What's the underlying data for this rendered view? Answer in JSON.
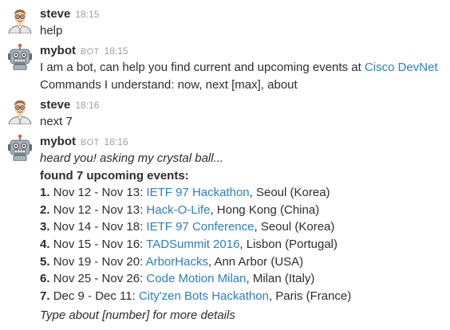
{
  "messages": [
    {
      "sender": "steve",
      "time": "18:15",
      "text": "help"
    },
    {
      "sender": "mybot",
      "badge": "BOT",
      "time": "18:15",
      "line1_prefix": "I am a bot, can help you find current and upcoming events at ",
      "line1_link": "Cisco DevNet",
      "line2": "Commands I understand: now, next [max], about"
    },
    {
      "sender": "steve",
      "time": "18:16",
      "text": "next 7"
    },
    {
      "sender": "mybot",
      "badge": "BOT",
      "time": "18:16",
      "intro": "heard you! asking my crystal ball...",
      "heading": "found 7 upcoming events:",
      "events": [
        {
          "num": "1.",
          "dates": "Nov 12 - Nov 13:",
          "name": "IETF 97 Hackathon",
          "location": ", Seoul (Korea)"
        },
        {
          "num": "2.",
          "dates": "Nov 12 - Nov 13:",
          "name": "Hack-O-Life",
          "location": ", Hong Kong (China)"
        },
        {
          "num": "3.",
          "dates": "Nov 14 - Nov 18:",
          "name": "IETF 97 Conference",
          "location": ", Seoul (Korea)"
        },
        {
          "num": "4.",
          "dates": "Nov 15 - Nov 16:",
          "name": "TADSummit 2016",
          "location": ", Lisbon (Portugal)"
        },
        {
          "num": "5.",
          "dates": "Nov 19 - Nov 20:",
          "name": "ArborHacks",
          "location": ", Ann Arbor (USA)"
        },
        {
          "num": "6.",
          "dates": "Nov 25 - Nov 26:",
          "name": "Code Motion Milan",
          "location": ", Milan (Italy)"
        },
        {
          "num": "7.",
          "dates": "Dec 9 - Dec 11:",
          "name": "City'zen Bots Hackathon",
          "location": ", Paris (France)"
        }
      ],
      "footer": "Type about [number] for more details"
    }
  ],
  "colors": {
    "link": "#2a80b9",
    "text": "#2c2d30",
    "muted": "#9e9ea6"
  },
  "icons": {
    "user_avatar": "person-avatar-icon",
    "bot_avatar": "robot-avatar-icon"
  }
}
